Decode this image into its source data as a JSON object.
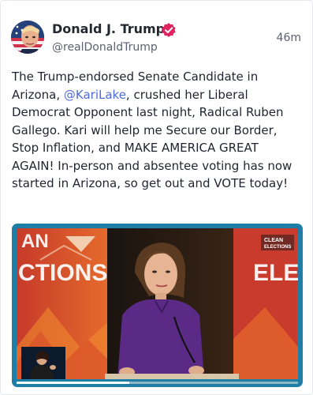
{
  "author": {
    "name": "Donald J. Trump",
    "handle": "@realDonaldTrump",
    "verified": true,
    "avatar_icon": "flag-portrait-avatar"
  },
  "post": {
    "time": "46m",
    "text_before": "The Trump-endorsed Senate Candidate in Arizona, ",
    "mention": "@KariLake",
    "text_after": ", crushed her Liberal Democrat Opponent last night, Radical Ruben Gallego. Kari will help me Secure our Border, Stop Inflation, and MAKE AMERICA GREAT AGAIN! In-person and absentee voting has now started in Arizona, so get out and VOTE today!",
    "mention_color": "#4f6bd6"
  },
  "media": {
    "backdrop_left_text_1": "AN",
    "backdrop_left_text_2": "CTIONS",
    "backdrop_right_text": "ELEC",
    "logo_line_1": "CLEAN",
    "logo_line_2": "ELECTIONS",
    "frame_color": "#1e7ea6",
    "progress": 0.4
  },
  "colors": {
    "verified_badge": "#e0245e",
    "text": "#1f2430",
    "muted": "#5b616e"
  }
}
